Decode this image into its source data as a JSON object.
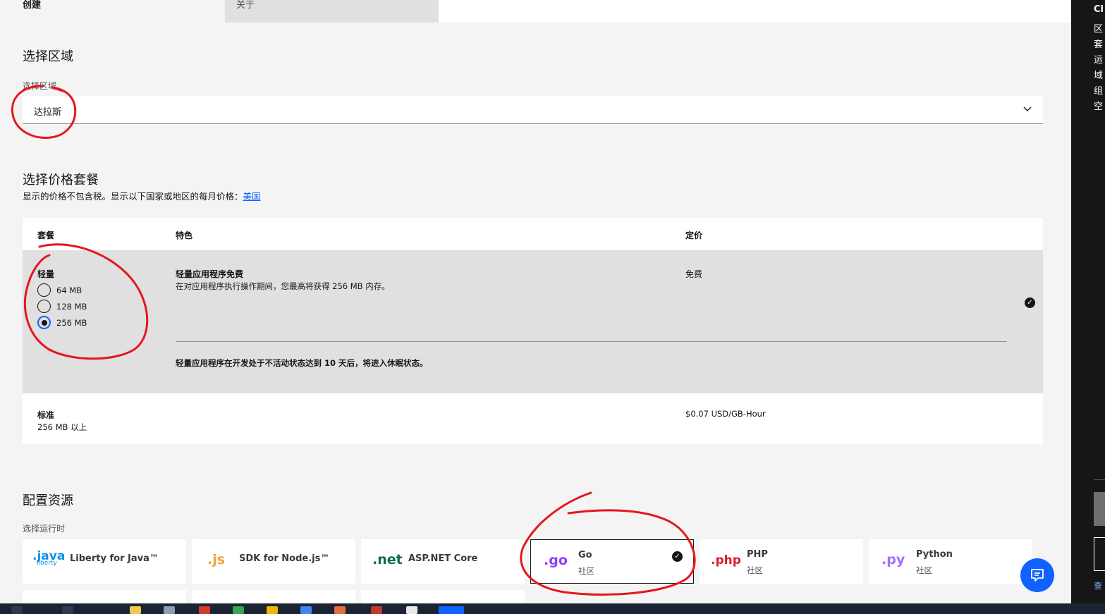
{
  "tabs": {
    "create": "创建",
    "about": "关于"
  },
  "region": {
    "heading": "选择区域",
    "label": "选择区域",
    "value": "达拉斯"
  },
  "pricing": {
    "heading": "选择价格套餐",
    "note_prefix": "显示的价格不包含税。显示以下国家或地区的每月价格：",
    "note_link": "美国",
    "columns": {
      "plan": "套餐",
      "features": "特色",
      "price": "定价"
    },
    "lite": {
      "name": "轻量",
      "options": [
        "64 MB",
        "128 MB",
        "256 MB"
      ],
      "selected": "256 MB",
      "feature_title": "轻量应用程序免费",
      "feature_desc": "在对应用程序执行操作期间，您最高将获得 256 MB 内存。",
      "sleep_note": "轻量应用程序在开发处于不活动状态达到 10 天后，将进入休眠状态。",
      "price": "免费"
    },
    "standard": {
      "name": "标准",
      "desc": "256 MB 以上",
      "price": "$0.07 USD/GB-Hour"
    }
  },
  "resources": {
    "heading": "配置资源",
    "runtime_label": "选择运行时",
    "runtimes": [
      {
        "logo": ".java",
        "logo_sub": "liberty",
        "name": "Liberty for Java™",
        "sub": "",
        "color": "#1192e8"
      },
      {
        "logo": ".js",
        "name": "SDK for Node.js™",
        "sub": "",
        "color": "#f1a33b"
      },
      {
        "logo": ".net",
        "name": "ASP.NET Core",
        "sub": "",
        "color": "#0e6e49"
      },
      {
        "logo": ".go",
        "name": "Go",
        "sub": "社区",
        "color": "#8a3ffc"
      },
      {
        "logo": ".php",
        "name": "PHP",
        "sub": "社区",
        "color": "#da1e28"
      },
      {
        "logo": ".py",
        "name": "Python",
        "sub": "社区",
        "color": "#a56eff"
      }
    ],
    "selected_runtime": "Go"
  },
  "side_panel": {
    "title": "Cl",
    "items": [
      "区",
      "套",
      "运",
      "域",
      "组",
      "空"
    ],
    "link": "查"
  },
  "colors": {
    "accent": "#0f62fe",
    "annotation": "#e5161d",
    "panel": "#161616"
  }
}
